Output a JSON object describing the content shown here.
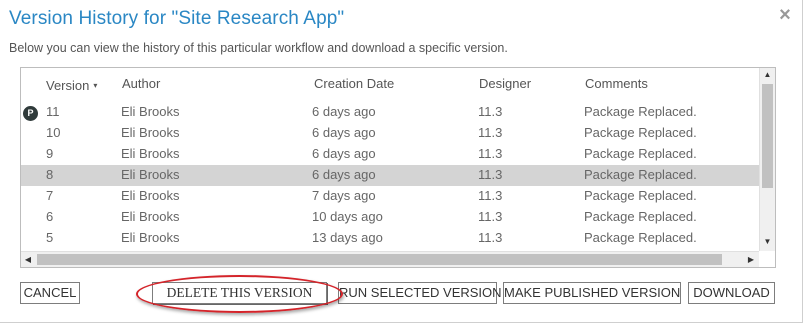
{
  "dialog": {
    "title": "Version History for \"Site Research App\"",
    "subtitle": "Below you can view the history of this particular workflow and download a specific version.",
    "close_icon": "×"
  },
  "table": {
    "headers": {
      "version": "Version",
      "author": "Author",
      "creation_date": "Creation Date",
      "designer": "Designer",
      "comments": "Comments"
    },
    "sort_indicator": "▾",
    "published_badge": "P",
    "rows": [
      {
        "version": "11",
        "author": "Eli Brooks",
        "date": "6 days ago",
        "designer": "11.3",
        "comments": "Package Replaced.",
        "published": true,
        "selected": false
      },
      {
        "version": "10",
        "author": "Eli Brooks",
        "date": "6 days ago",
        "designer": "11.3",
        "comments": "Package Replaced.",
        "published": false,
        "selected": false
      },
      {
        "version": "9",
        "author": "Eli Brooks",
        "date": "6 days ago",
        "designer": "11.3",
        "comments": "Package Replaced.",
        "published": false,
        "selected": false
      },
      {
        "version": "8",
        "author": "Eli Brooks",
        "date": "6 days ago",
        "designer": "11.3",
        "comments": "Package Replaced.",
        "published": false,
        "selected": true
      },
      {
        "version": "7",
        "author": "Eli Brooks",
        "date": "7 days ago",
        "designer": "11.3",
        "comments": "Package Replaced.",
        "published": false,
        "selected": false
      },
      {
        "version": "6",
        "author": "Eli Brooks",
        "date": "10 days ago",
        "designer": "11.3",
        "comments": "Package Replaced.",
        "published": false,
        "selected": false
      },
      {
        "version": "5",
        "author": "Eli Brooks",
        "date": "13 days ago",
        "designer": "11.3",
        "comments": "Package Replaced.",
        "published": false,
        "selected": false
      }
    ]
  },
  "buttons": {
    "cancel": "CANCEL",
    "delete": "DELETE THIS VERSION",
    "run": "RUN SELECTED VERSION",
    "publish": "MAKE PUBLISHED VERSION",
    "download": "DOWNLOAD"
  },
  "colors": {
    "title": "#2a87c4",
    "selected_row": "#d4d4d4",
    "highlight": "#d4242a",
    "badge": "#2f3a3a"
  }
}
